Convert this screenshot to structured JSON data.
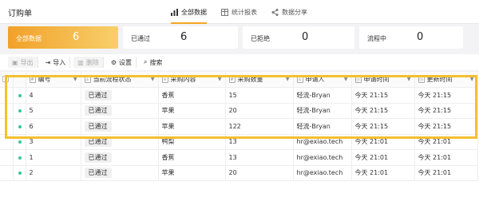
{
  "app": {
    "title": "订购单"
  },
  "nav": [
    {
      "label": "全部数据",
      "icon": "bar-chart-icon",
      "active": true
    },
    {
      "label": "统计报表",
      "icon": "table-icon",
      "active": false
    },
    {
      "label": "数据分享",
      "icon": "share-icon",
      "active": false
    }
  ],
  "stats": [
    {
      "label": "全部数据",
      "value": "6"
    },
    {
      "label": "已通过",
      "value": "6"
    },
    {
      "label": "已拒绝",
      "value": "0"
    },
    {
      "label": "流程中",
      "value": "0"
    }
  ],
  "toolbar": {
    "export": "导出",
    "import": "导入",
    "delete": "删除",
    "settings": "设置",
    "search": "搜索"
  },
  "table": {
    "headers": [
      "编号",
      "当前流程状态",
      "采购内容",
      "采购数量",
      "申请人",
      "申请时间",
      "更新时间"
    ],
    "rows": [
      [
        "4",
        "已通过",
        "香蕉",
        "15",
        "轻流-Bryan",
        "今天 21:15",
        "今天 21:15"
      ],
      [
        "5",
        "已通过",
        "苹果",
        "20",
        "轻流-Bryan",
        "今天 21:15",
        "今天 21:15"
      ],
      [
        "6",
        "已通过",
        "苹果",
        "122",
        "轻流-Bryan",
        "今天 21:15",
        "今天 21:15"
      ],
      [
        "3",
        "已通过",
        "鸭梨",
        "13",
        "hr@exiao.tech",
        "今天 21:01",
        "今天 21:01"
      ],
      [
        "1",
        "已通过",
        "香蕉",
        "13",
        "hr@exiao.tech",
        "今天 21:01",
        "今天 21:01"
      ],
      [
        "2",
        "已通过",
        "苹果",
        "20",
        "hr@exiao.tech",
        "今天 21:01",
        "今天 21:01"
      ]
    ]
  },
  "colors": {
    "accent": "#f5a623",
    "highlight": "#f4c030",
    "status_dot": "#35c5a0"
  }
}
